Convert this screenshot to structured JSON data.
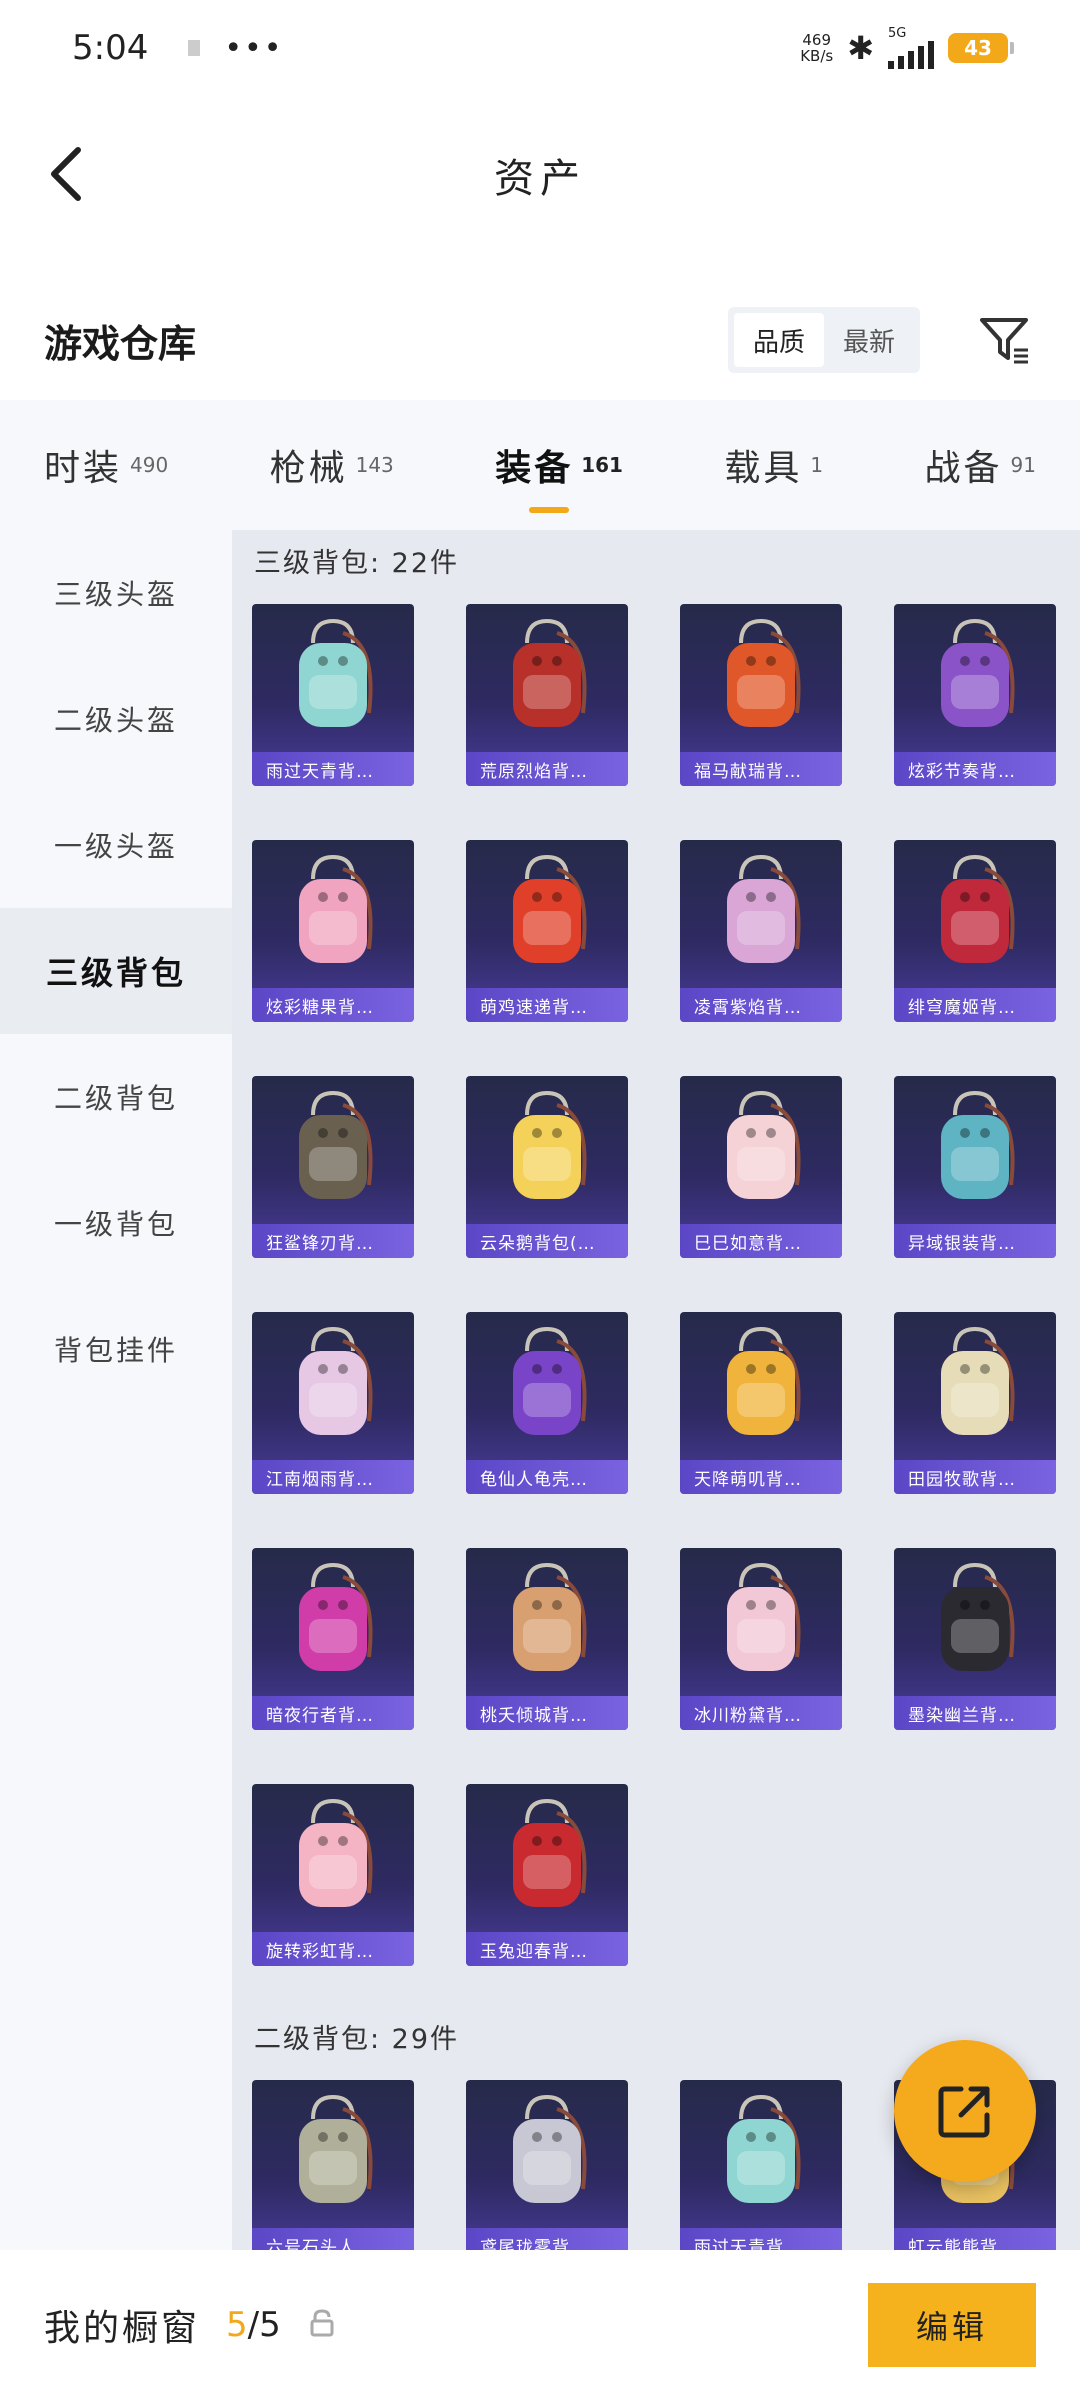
{
  "status_bar": {
    "time": "5:04",
    "dots": "•••",
    "net_speed_value": "469",
    "net_speed_unit": "KB/s",
    "network": "5G",
    "battery": "43"
  },
  "header": {
    "title": "资产"
  },
  "warehouse": {
    "title": "游戏仓库",
    "sort_options": [
      "品质",
      "最新"
    ],
    "active_sort": "品质"
  },
  "tabs": [
    {
      "name": "时装",
      "count": "490"
    },
    {
      "name": "枪械",
      "count": "143"
    },
    {
      "name": "装备",
      "count": "161"
    },
    {
      "name": "载具",
      "count": "1"
    },
    {
      "name": "战备",
      "count": "91"
    }
  ],
  "active_tab": "装备",
  "sidebar": [
    {
      "label": "三级头盔"
    },
    {
      "label": "二级头盔"
    },
    {
      "label": "一级头盔"
    },
    {
      "label": "三级背包"
    },
    {
      "label": "二级背包"
    },
    {
      "label": "一级背包"
    },
    {
      "label": "背包挂件"
    }
  ],
  "active_sidebar": "三级背包",
  "sections": [
    {
      "title": "三级背包: 22件",
      "items": [
        {
          "name": "雨过天青背…",
          "color": "#8fd6d2"
        },
        {
          "name": "荒原烈焰背…",
          "color": "#b8302a"
        },
        {
          "name": "福马献瑞背…",
          "color": "#e0582a"
        },
        {
          "name": "炫彩节奏背…",
          "color": "#8a54c8"
        },
        {
          "name": "炫彩糖果背…",
          "color": "#f0a4bf"
        },
        {
          "name": "萌鸡速递背…",
          "color": "#e0402a"
        },
        {
          "name": "凌霄紫焰背…",
          "color": "#d9a6d6"
        },
        {
          "name": "绯穹魔姬背…",
          "color": "#c0283c"
        },
        {
          "name": "狂鲨锋刃背…",
          "color": "#6a6050"
        },
        {
          "name": "云朵鹅背包(…",
          "color": "#f4d25a"
        },
        {
          "name": "巳巳如意背…",
          "color": "#f5d2d6"
        },
        {
          "name": "异域银装背…",
          "color": "#5fb4c4"
        },
        {
          "name": "江南烟雨背…",
          "color": "#e6c8e4"
        },
        {
          "name": "龟仙人龟壳…",
          "color": "#7a44c8"
        },
        {
          "name": "天降萌叽背…",
          "color": "#f0b43c"
        },
        {
          "name": "田园牧歌背…",
          "color": "#e6dcb8"
        },
        {
          "name": "暗夜行者背…",
          "color": "#d03ca8"
        },
        {
          "name": "桃夭倾城背…",
          "color": "#d8a070"
        },
        {
          "name": "冰川粉黛背…",
          "color": "#f2c8d6"
        },
        {
          "name": "墨染幽兰背…",
          "color": "#2a2a30"
        },
        {
          "name": "旋转彩虹背…",
          "color": "#f4b4c4"
        },
        {
          "name": "玉兔迎春背…",
          "color": "#c82a30"
        }
      ]
    },
    {
      "title": "二级背包: 29件",
      "items": [
        {
          "name": "六号石头人…",
          "color": "#b0b09a"
        },
        {
          "name": "鸢尾珑雾背…",
          "color": "#c8c8d4"
        },
        {
          "name": "雨过天青背…",
          "color": "#8fd6d2"
        },
        {
          "name": "虹云熊熊背…",
          "color": "#e8c060"
        }
      ]
    }
  ],
  "bottom_bar": {
    "title": "我的橱窗",
    "count_used": "5",
    "count_sep": "/5",
    "edit_label": "编辑"
  },
  "colors": {
    "accent": "#f2a818",
    "card_caption": "#6a55d4",
    "card_bg": "#2b2a55"
  }
}
